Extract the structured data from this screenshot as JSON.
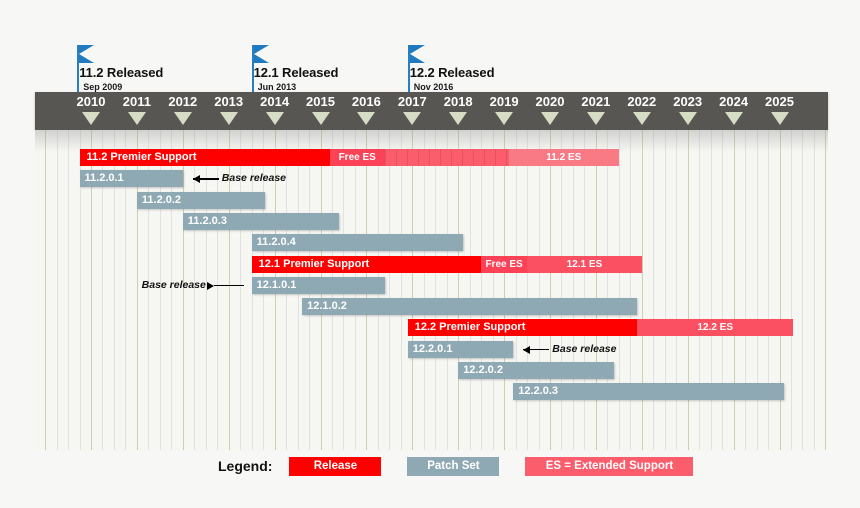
{
  "chart_data": {
    "type": "bar",
    "title": "",
    "xlabel": "",
    "ylabel": "",
    "axis": {
      "type": "year-timeline",
      "start_year": 2010,
      "end_year": 2025,
      "tick_labels": [
        "2010",
        "2011",
        "2012",
        "2013",
        "2014",
        "2015",
        "2016",
        "2017",
        "2018",
        "2019",
        "2020",
        "2021",
        "2022",
        "2023",
        "2024",
        "2025"
      ],
      "grid": "quarterly",
      "band_color": "#585653",
      "tick_marker_color": "#d6ddc4"
    },
    "milestones": [
      {
        "label": "11.2 Released",
        "date": "Sep 2009",
        "year_position": 2009.7
      },
      {
        "label": "12.1 Released",
        "date": "Jun 2013",
        "year_position": 2013.5
      },
      {
        "label": "12.2 Released",
        "date": "Nov 2016",
        "year_position": 2016.9
      }
    ],
    "rows": [
      {
        "name": "11.2 Premier Support",
        "kind": "release",
        "start_year": 2009.75,
        "end_year": 2021.5,
        "segments": [
          {
            "label": "11.2 Premier Support",
            "kind": "premier",
            "start_year": 2009.75,
            "end_year": 2015.2,
            "color": "#ff0000"
          },
          {
            "label": "Free ES",
            "kind": "free-es",
            "start_year": 2015.2,
            "end_year": 2016.4,
            "color": "#fb4257"
          },
          {
            "label": "",
            "kind": "striped-es",
            "start_year": 2016.4,
            "end_year": 2019.1,
            "color": "#fb5d6d"
          },
          {
            "label": "11.2 ES",
            "kind": "extended-support",
            "start_year": 2019.1,
            "end_year": 2021.5,
            "color": "#f97a85"
          }
        ]
      },
      {
        "name": "11.2.0.1",
        "kind": "patch",
        "start_year": 2009.75,
        "end_year": 2012.0,
        "annotation": "Base release",
        "annotation_side": "right"
      },
      {
        "name": "11.2.0.2",
        "kind": "patch",
        "start_year": 2011.0,
        "end_year": 2013.8
      },
      {
        "name": "11.2.0.3",
        "kind": "patch",
        "start_year": 2012.0,
        "end_year": 2015.4
      },
      {
        "name": "11.2.0.4",
        "kind": "patch",
        "start_year": 2013.5,
        "end_year": 2018.1
      },
      {
        "name": "12.1 Premier Support",
        "kind": "release",
        "start_year": 2013.5,
        "end_year": 2022.0,
        "segments": [
          {
            "label": "12.1 Premier Support",
            "kind": "premier",
            "start_year": 2013.5,
            "end_year": 2018.5,
            "color": "#ff0000"
          },
          {
            "label": "Free ES",
            "kind": "free-es",
            "start_year": 2018.5,
            "end_year": 2019.5,
            "color": "#fb4257"
          },
          {
            "label": "12.1 ES",
            "kind": "extended-support",
            "start_year": 2019.5,
            "end_year": 2022.0,
            "color": "#fb4f62"
          }
        ]
      },
      {
        "name": "12.1.0.1",
        "kind": "patch",
        "start_year": 2013.5,
        "end_year": 2016.4,
        "annotation": "Base release",
        "annotation_side": "left"
      },
      {
        "name": "12.1.0.2",
        "kind": "patch",
        "start_year": 2014.6,
        "end_year": 2021.9
      },
      {
        "name": "12.2 Premier Support",
        "kind": "release",
        "start_year": 2016.9,
        "end_year": 2025.3,
        "segments": [
          {
            "label": "12.2 Premier Support",
            "kind": "premier",
            "start_year": 2016.9,
            "end_year": 2021.9,
            "color": "#ff0000"
          },
          {
            "label": "12.2 ES",
            "kind": "extended-support",
            "start_year": 2021.9,
            "end_year": 2025.3,
            "color": "#fb4f62"
          }
        ]
      },
      {
        "name": "12.2.0.1",
        "kind": "patch",
        "start_year": 2016.9,
        "end_year": 2019.2,
        "annotation": "Base release",
        "annotation_side": "right"
      },
      {
        "name": "12.2.0.2",
        "kind": "patch",
        "start_year": 2018.0,
        "end_year": 2021.4
      },
      {
        "name": "12.2.0.3",
        "kind": "patch",
        "start_year": 2019.2,
        "end_year": 2025.1
      }
    ],
    "legend": {
      "title": "Legend:",
      "entries": [
        {
          "label": "Release",
          "color": "#ff0000"
        },
        {
          "label": "Patch Set",
          "color": "#8fa9b4"
        },
        {
          "label": "ES = Extended Support",
          "color": "#fb5d6d"
        }
      ]
    }
  },
  "legend": {
    "title": "Legend:",
    "release_label": "Release",
    "patch_label": "Patch Set",
    "es_label": "ES = Extended Support"
  }
}
